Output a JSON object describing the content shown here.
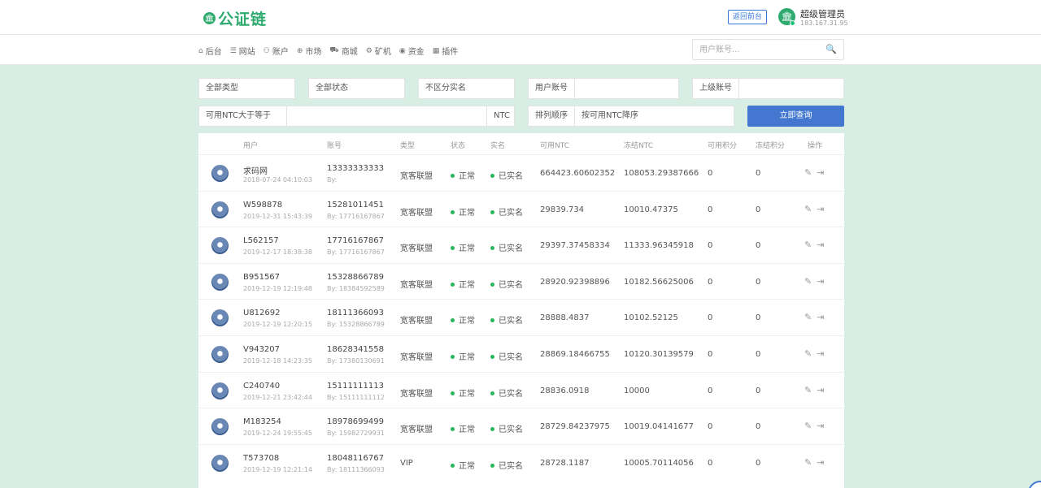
{
  "header": {
    "logo_icon": "🏛",
    "logo_text": "公证链",
    "back_label": "返回前台",
    "admin_icon": "🏛",
    "admin_name": "超级管理员",
    "admin_ip": "183.167.31.95"
  },
  "nav": {
    "items": [
      {
        "icon": "⌂",
        "label": "后台"
      },
      {
        "icon": "☰",
        "label": "网站"
      },
      {
        "icon": "⚇",
        "label": "账户"
      },
      {
        "icon": "⊕",
        "label": "市场"
      },
      {
        "icon": "⛟",
        "label": "商城"
      },
      {
        "icon": "⚙",
        "label": "矿机"
      },
      {
        "icon": "◉",
        "label": "资金"
      },
      {
        "icon": "▦",
        "label": "插件"
      }
    ],
    "search_placeholder": "用户账号...",
    "search_icon": "🔍"
  },
  "filters": {
    "type": "全部类型",
    "status": "全部状态",
    "realname": "不区分实名",
    "user_account_label": "用户账号",
    "parent_account_label": "上级账号",
    "ntc_gte_label": "可用NTC大于等于",
    "ntc_unit": "NTC",
    "sort_label": "排列顺序",
    "sort_value": "按可用NTC降序",
    "query_button": "立即查询"
  },
  "table": {
    "headers": [
      "用户",
      "账号",
      "类型",
      "状态",
      "实名",
      "可用NTC",
      "冻结NTC",
      "可用积分",
      "冻结积分",
      "操作"
    ],
    "rows": [
      {
        "name": "求码网",
        "date": "2018-07-24 04:10:03",
        "account": "13333333333",
        "by": "By:",
        "type": "宽客联盟",
        "status": "正常",
        "real": "已实名",
        "ntc": "664423.60602352",
        "frozen": "108053.29387666",
        "points": "0",
        "fpoints": "0"
      },
      {
        "name": "W598878",
        "date": "2019-12-31 15:43:39",
        "account": "15281011451",
        "by": "By: 17716167867",
        "type": "宽客联盟",
        "status": "正常",
        "real": "已实名",
        "ntc": "29839.734",
        "frozen": "10010.47375",
        "points": "0",
        "fpoints": "0"
      },
      {
        "name": "L562157",
        "date": "2019-12-17 18:38:38",
        "account": "17716167867",
        "by": "By: 17716167867",
        "type": "宽客联盟",
        "status": "正常",
        "real": "已实名",
        "ntc": "29397.37458334",
        "frozen": "11333.96345918",
        "points": "0",
        "fpoints": "0"
      },
      {
        "name": "B951567",
        "date": "2019-12-19 12:19:48",
        "account": "15328866789",
        "by": "By: 18384592589",
        "type": "宽客联盟",
        "status": "正常",
        "real": "已实名",
        "ntc": "28920.92398896",
        "frozen": "10182.56625006",
        "points": "0",
        "fpoints": "0"
      },
      {
        "name": "U812692",
        "date": "2019-12-19 12:20:15",
        "account": "18111366093",
        "by": "By: 15328866789",
        "type": "宽客联盟",
        "status": "正常",
        "real": "已实名",
        "ntc": "28888.4837",
        "frozen": "10102.52125",
        "points": "0",
        "fpoints": "0"
      },
      {
        "name": "V943207",
        "date": "2019-12-18 14:23:35",
        "account": "18628341558",
        "by": "By: 17380130691",
        "type": "宽客联盟",
        "status": "正常",
        "real": "已实名",
        "ntc": "28869.18466755",
        "frozen": "10120.30139579",
        "points": "0",
        "fpoints": "0"
      },
      {
        "name": "C240740",
        "date": "2019-12-21 23:42:44",
        "account": "15111111113",
        "by": "By: 15111111112",
        "type": "宽客联盟",
        "status": "正常",
        "real": "已实名",
        "ntc": "28836.0918",
        "frozen": "10000",
        "points": "0",
        "fpoints": "0"
      },
      {
        "name": "M183254",
        "date": "2019-12-24 19:55:45",
        "account": "18978699499",
        "by": "By: 15982729931",
        "type": "宽客联盟",
        "status": "正常",
        "real": "已实名",
        "ntc": "28729.84237975",
        "frozen": "10019.04141677",
        "points": "0",
        "fpoints": "0"
      },
      {
        "name": "T573708",
        "date": "2019-12-19 12:21:14",
        "account": "18048116767",
        "by": "By: 18111366093",
        "type": "VIP",
        "status": "正常",
        "real": "已实名",
        "ntc": "28728.1187",
        "frozen": "10005.70114056",
        "points": "0",
        "fpoints": "0"
      }
    ],
    "edit_icon": "✎",
    "login_icon": "⇥"
  }
}
